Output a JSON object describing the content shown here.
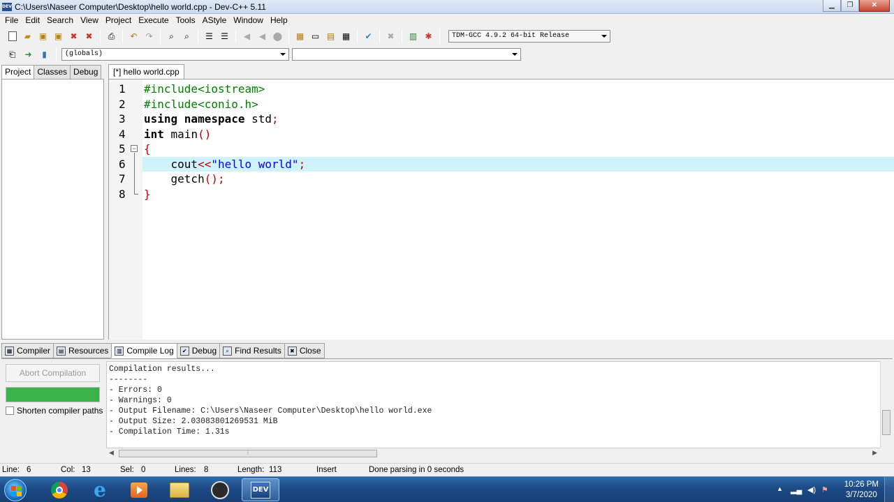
{
  "window": {
    "title": "C:\\Users\\Naseer Computer\\Desktop\\hello world.cpp - Dev-C++ 5.11",
    "icon_label": "DEV",
    "controls": [
      "minimize",
      "maximize",
      "close"
    ]
  },
  "menu": [
    "File",
    "Edit",
    "Search",
    "View",
    "Project",
    "Execute",
    "Tools",
    "AStyle",
    "Window",
    "Help"
  ],
  "toolbar": {
    "compiler_select": "TDM-GCC 4.9.2 64-bit Release",
    "scope_combo": "(globals)",
    "function_combo": ""
  },
  "left_panel": {
    "tabs": [
      "Project",
      "Classes",
      "Debug"
    ],
    "active_tab": "Project"
  },
  "editor": {
    "tab_label": "[*] hello world.cpp",
    "current_line": 6,
    "lines": [
      {
        "num": "1",
        "tokens": [
          {
            "t": "#include<iostream>",
            "c": "pre"
          }
        ]
      },
      {
        "num": "2",
        "tokens": [
          {
            "t": "#include<conio.h>",
            "c": "pre"
          }
        ]
      },
      {
        "num": "3",
        "tokens": [
          {
            "t": "using namespace",
            "c": "kw"
          },
          {
            "t": " std",
            "c": "id"
          },
          {
            "t": ";",
            "c": "sym"
          }
        ]
      },
      {
        "num": "4",
        "tokens": [
          {
            "t": "int",
            "c": "kw"
          },
          {
            "t": " main",
            "c": "id"
          },
          {
            "t": "()",
            "c": "sym"
          }
        ]
      },
      {
        "num": "5",
        "tokens": [
          {
            "t": "{",
            "c": "sym"
          }
        ]
      },
      {
        "num": "6",
        "tokens": [
          {
            "t": "    cout",
            "c": "id"
          },
          {
            "t": "<<",
            "c": "sym"
          },
          {
            "t": "\"hello world\"",
            "c": "str"
          },
          {
            "t": ";",
            "c": "sym"
          }
        ]
      },
      {
        "num": "7",
        "tokens": [
          {
            "t": "    getch",
            "c": "id"
          },
          {
            "t": "();",
            "c": "sym"
          }
        ]
      },
      {
        "num": "8",
        "tokens": [
          {
            "t": "}",
            "c": "sym"
          }
        ]
      }
    ]
  },
  "bottom_panel": {
    "tabs": [
      {
        "label": "Compiler",
        "icon": "grid-icon"
      },
      {
        "label": "Resources",
        "icon": "resources-icon"
      },
      {
        "label": "Compile Log",
        "icon": "bar-chart-icon"
      },
      {
        "label": "Debug",
        "icon": "check-icon"
      },
      {
        "label": "Find Results",
        "icon": "find-icon"
      },
      {
        "label": "Close",
        "icon": "close-icon"
      }
    ],
    "active_tab": "Compile Log",
    "abort_button": "Abort Compilation",
    "progress": 1.0,
    "shorten_paths_label": "Shorten compiler paths",
    "shorten_paths_checked": false,
    "log_lines": [
      "Compilation results...",
      "--------",
      "- Errors: 0",
      "- Warnings: 0",
      "- Output Filename: C:\\Users\\Naseer Computer\\Desktop\\hello world.exe",
      "- Output Size: 2.03083801269531 MiB",
      "- Compilation Time: 1.31s"
    ]
  },
  "status_bar": {
    "line_label": "Line:",
    "line_value": "6",
    "col_label": "Col:",
    "col_value": "13",
    "sel_label": "Sel:",
    "sel_value": "0",
    "lines_label": "Lines:",
    "lines_value": "8",
    "length_label": "Length:",
    "length_value": "113",
    "mode": "Insert",
    "message": "Done parsing in 0 seconds"
  },
  "taskbar": {
    "apps": [
      "start",
      "chrome",
      "internet-explorer",
      "media-player",
      "file-explorer",
      "obs",
      "dev-cpp"
    ],
    "dev_label": "DEV",
    "time": "10:26 PM",
    "date": "3/7/2020"
  }
}
